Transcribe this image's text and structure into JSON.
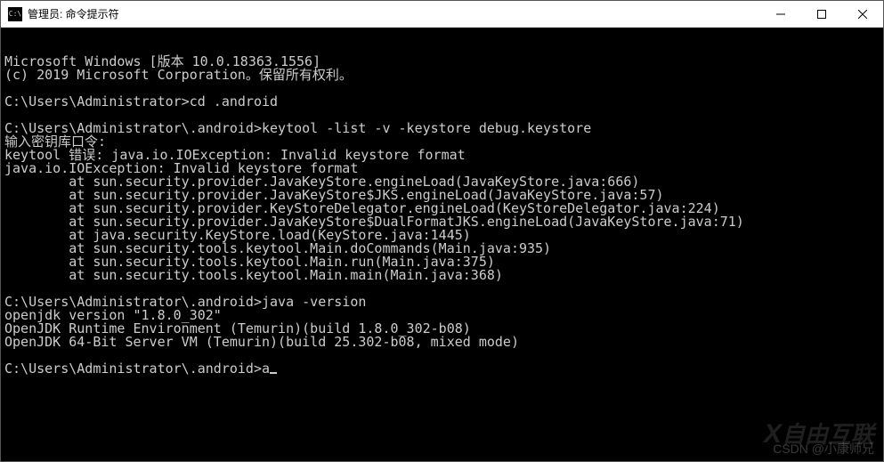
{
  "titlebar": {
    "icon_label": "C:\\",
    "title": "管理员: 命令提示符"
  },
  "terminal": {
    "lines": [
      "Microsoft Windows [版本 10.0.18363.1556]",
      "(c) 2019 Microsoft Corporation。保留所有权利。",
      "",
      "C:\\Users\\Administrator>cd .android",
      "",
      "C:\\Users\\Administrator\\.android>keytool -list -v -keystore debug.keystore",
      "输入密钥库口令:",
      "keytool 错误: java.io.IOException: Invalid keystore format",
      "java.io.IOException: Invalid keystore format",
      "        at sun.security.provider.JavaKeyStore.engineLoad(JavaKeyStore.java:666)",
      "        at sun.security.provider.JavaKeyStore$JKS.engineLoad(JavaKeyStore.java:57)",
      "        at sun.security.provider.KeyStoreDelegator.engineLoad(KeyStoreDelegator.java:224)",
      "        at sun.security.provider.JavaKeyStore$DualFormatJKS.engineLoad(JavaKeyStore.java:71)",
      "        at java.security.KeyStore.load(KeyStore.java:1445)",
      "        at sun.security.tools.keytool.Main.doCommands(Main.java:935)",
      "        at sun.security.tools.keytool.Main.run(Main.java:375)",
      "        at sun.security.tools.keytool.Main.main(Main.java:368)",
      "",
      "C:\\Users\\Administrator\\.android>java -version",
      "openjdk version \"1.8.0_302\"",
      "OpenJDK Runtime Environment (Temurin)(build 1.8.0_302-b08)",
      "OpenJDK 64-Bit Server VM (Temurin)(build 25.302-b08, mixed mode)",
      "",
      "C:\\Users\\Administrator\\.android>a"
    ],
    "cursor_after_last": true
  },
  "watermarks": {
    "brand": "自由互联",
    "attribution": "CSDN @小康师兄"
  }
}
